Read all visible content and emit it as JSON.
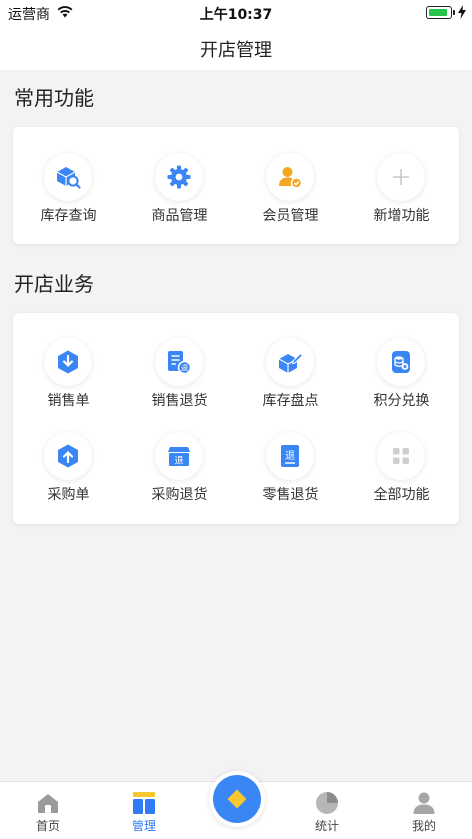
{
  "status_bar": {
    "carrier": "运营商",
    "time": "上午10:37",
    "battery_level": 0.9
  },
  "nav": {
    "title": "开店管理"
  },
  "common_section": {
    "title": "常用功能",
    "items": [
      {
        "label": "库存查询",
        "icon": "inventory-search-icon"
      },
      {
        "label": "商品管理",
        "icon": "gear-icon"
      },
      {
        "label": "会员管理",
        "icon": "member-icon"
      },
      {
        "label": "新增功能",
        "icon": "plus-icon"
      }
    ]
  },
  "business_section": {
    "title": "开店业务",
    "items": [
      {
        "label": "销售单",
        "icon": "sales-order-icon"
      },
      {
        "label": "销售退货",
        "icon": "sales-return-icon"
      },
      {
        "label": "库存盘点",
        "icon": "stocktake-icon"
      },
      {
        "label": "积分兑换",
        "icon": "points-exchange-icon"
      },
      {
        "label": "采购单",
        "icon": "purchase-order-icon"
      },
      {
        "label": "采购退货",
        "icon": "purchase-return-icon"
      },
      {
        "label": "零售退货",
        "icon": "retail-return-icon"
      },
      {
        "label": "全部功能",
        "icon": "grid-icon"
      }
    ]
  },
  "tab_bar": {
    "tabs": [
      {
        "label": "首页",
        "icon": "home-icon",
        "active": false
      },
      {
        "label": "管理",
        "icon": "manage-icon",
        "active": true
      },
      {
        "label": "统计",
        "icon": "pie-chart-icon",
        "active": false
      },
      {
        "label": "我的",
        "icon": "user-icon",
        "active": false
      }
    ]
  },
  "colors": {
    "accent": "#2f7cf6",
    "icon_blue": "#3a86f4",
    "member_orange": "#f5a623",
    "fab_diamond": "#f7c72f"
  }
}
